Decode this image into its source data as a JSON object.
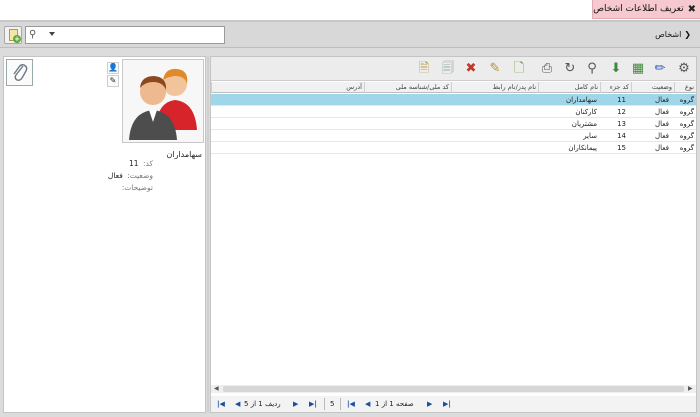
{
  "window": {
    "title": "تعریف اطلاعات اشخاص",
    "close_icon": "close-icon"
  },
  "breadcrumb": {
    "label": "اشخاص"
  },
  "search": {
    "placeholder": "",
    "value": ""
  },
  "detail": {
    "name": "سهامداران",
    "code_label": "کد:",
    "code_value": "11",
    "status_label": "وضعیت:",
    "status_value": "فعال",
    "desc_label": "توضیحات:",
    "desc_value": ""
  },
  "grid": {
    "columns": [
      "نوع",
      "وضعیت",
      "کد جزء",
      "نام کامل",
      "نام پدر/نام رابط",
      "کد ملی/شناسه ملی",
      "آدرس"
    ],
    "rows": [
      {
        "type": "گروه",
        "status": "فعال",
        "code": "11",
        "name": "سهامداران",
        "selected": true
      },
      {
        "type": "گروه",
        "status": "فعال",
        "code": "12",
        "name": "کارکنان",
        "selected": false
      },
      {
        "type": "گروه",
        "status": "فعال",
        "code": "13",
        "name": "مشتریان",
        "selected": false
      },
      {
        "type": "گروه",
        "status": "فعال",
        "code": "14",
        "name": "سایر",
        "selected": false
      },
      {
        "type": "گروه",
        "status": "فعال",
        "code": "15",
        "name": "پیمانکاران",
        "selected": false
      }
    ]
  },
  "pager": {
    "page_text": "صفحه 1 از 1",
    "page_size": "5",
    "row_text": "ردیف 1 از 5"
  },
  "colors": {
    "selected_row": "#9fd6ea",
    "title_tab": "#f6c9cf"
  }
}
